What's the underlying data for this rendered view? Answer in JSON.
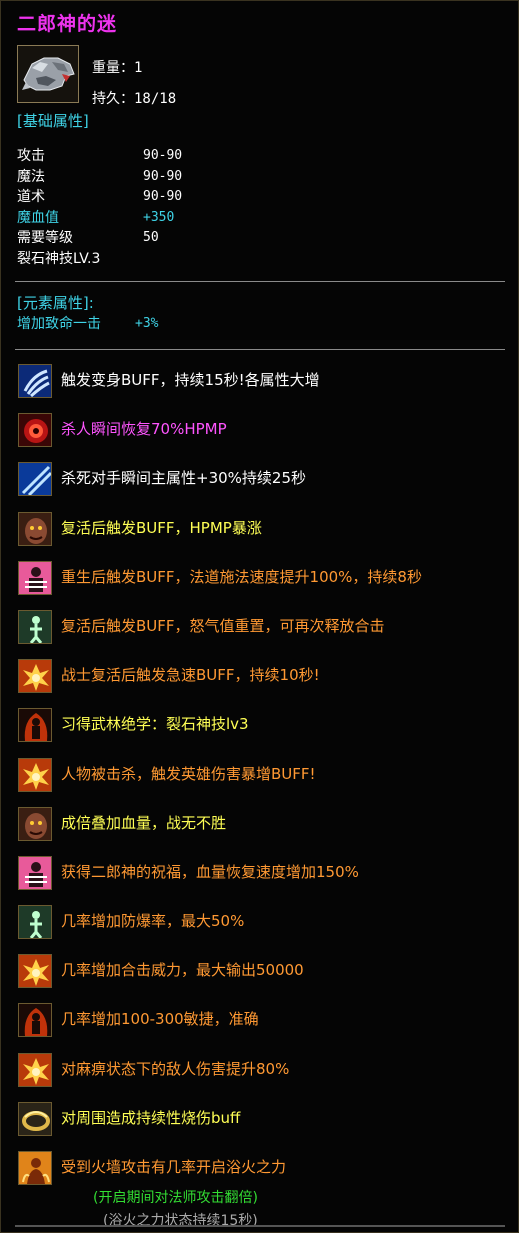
{
  "item": {
    "name": "二郎神的迷",
    "weight_label": "重量：",
    "weight_value": "1",
    "durability_label": "持久：",
    "durability_value": "18/18",
    "icon": "wolf-helmet-icon"
  },
  "base_section": {
    "header": "[基础属性]",
    "stats": [
      {
        "label": "攻击",
        "value": "90-90",
        "color": "#ffffff"
      },
      {
        "label": "魔法",
        "value": "90-90",
        "color": "#ffffff"
      },
      {
        "label": "道术",
        "value": "90-90",
        "color": "#ffffff"
      },
      {
        "label": "魔血值",
        "value": "+350",
        "color": "#3fd3e6"
      },
      {
        "label": "需要等级",
        "value": "50",
        "color": "#ffffff"
      },
      {
        "label": "裂石神技LV.3",
        "value": "",
        "color": "#ffffff"
      }
    ]
  },
  "element_section": {
    "header": "[元素属性]:",
    "line_label": "增加致命一击",
    "line_value": "+3%"
  },
  "skills": [
    {
      "text": "触发变身BUFF，持续15秒!各属性大增",
      "color": "#ffffff",
      "icon": "blue-claw-icon"
    },
    {
      "text": "杀人瞬间恢复70%HPMP",
      "color": "#ff55ff",
      "icon": "red-eye-icon"
    },
    {
      "text": "杀死对手瞬间主属性+30%持续25秒",
      "color": "#ffffff",
      "icon": "blue-slash-icon"
    },
    {
      "text": "复活后触发BUFF，HPMP暴涨",
      "color": "#ffff55",
      "icon": "demon-face-icon"
    },
    {
      "text": "重生后触发BUFF，法道施法速度提升100%，持续8秒",
      "color": "#ff9933",
      "icon": "pink-warrior-icon"
    },
    {
      "text": "复活后触发BUFF，怒气值重置，可再次释放合击",
      "color": "#ff9933",
      "icon": "green-spirit-icon"
    },
    {
      "text": "战士复活后触发急速BUFF，持续10秒!",
      "color": "#ff9933",
      "icon": "fire-burst-icon"
    },
    {
      "text": "习得武林绝学：裂石神技lv3",
      "color": "#ffff55",
      "icon": "fire-figure-icon"
    },
    {
      "text": "人物被击杀，触发英雄伤害暴增BUFF!",
      "color": "#ff9933",
      "icon": "fire-burst-icon"
    },
    {
      "text": "成倍叠加血量，战无不胜",
      "color": "#ffff55",
      "icon": "demon-face-icon"
    },
    {
      "text": "获得二郎神的祝福，血量恢复速度增加150%",
      "color": "#ff9933",
      "icon": "pink-warrior-icon"
    },
    {
      "text": "几率增加防爆率，最大50%",
      "color": "#ff9933",
      "icon": "green-spirit-icon"
    },
    {
      "text": "几率增加合击威力，最大输出50000",
      "color": "#ff9933",
      "icon": "fire-burst-icon"
    },
    {
      "text": "几率增加100-300敏捷，准确",
      "color": "#ff9933",
      "icon": "fire-figure-icon"
    },
    {
      "text": "对麻痹状态下的敌人伤害提升80%",
      "color": "#ff9933",
      "icon": "fire-burst-icon"
    },
    {
      "text": "对周围造成持续性烧伤buff",
      "color": "#ffff55",
      "icon": "golden-ring-icon"
    },
    {
      "text": "受到火墙攻击有几率开启浴火之力",
      "color": "#ff9933",
      "icon": "flame-figure-icon"
    }
  ],
  "footnotes": [
    {
      "text": "(开启期间对法师攻击翻倍)",
      "color": "#33dd33"
    },
    {
      "text": "(浴火之力状态持续15秒)",
      "color": "#aaaaaa"
    }
  ]
}
